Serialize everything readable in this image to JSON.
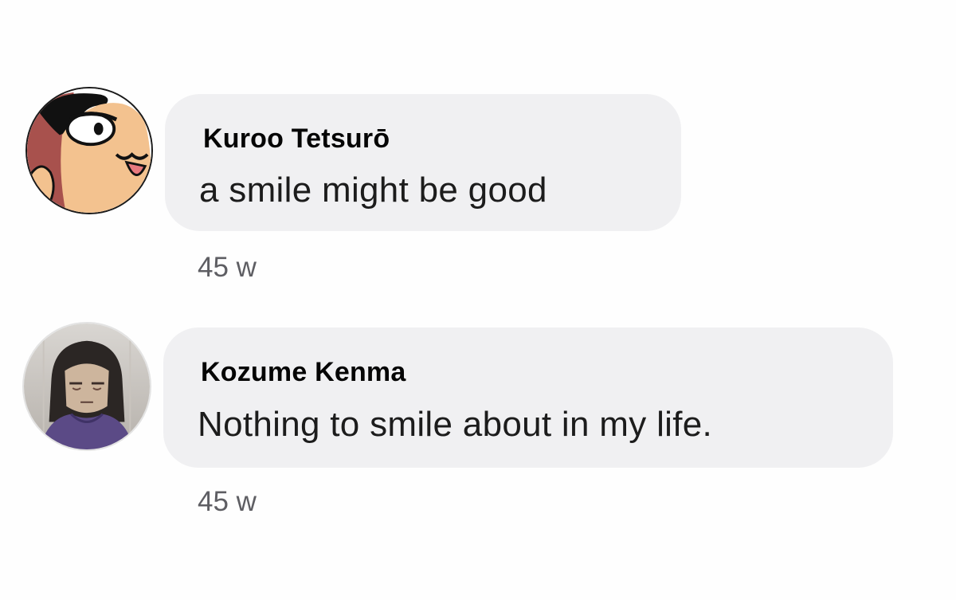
{
  "comments": [
    {
      "author": "Kuroo Tetsurō",
      "text": "a smile might be good",
      "time": "45 w",
      "avatar_icon": "cartoon-cat-face-avatar"
    },
    {
      "author": "Kozume Kenma",
      "text": "Nothing to smile about in my life.",
      "time": "45 w",
      "avatar_icon": "anime-character-photo-avatar"
    }
  ],
  "colors": {
    "bubble_bg": "#f0f0f2",
    "author_text": "#050505",
    "body_text": "#1c1c1c",
    "timestamp_text": "#5e5e63"
  }
}
